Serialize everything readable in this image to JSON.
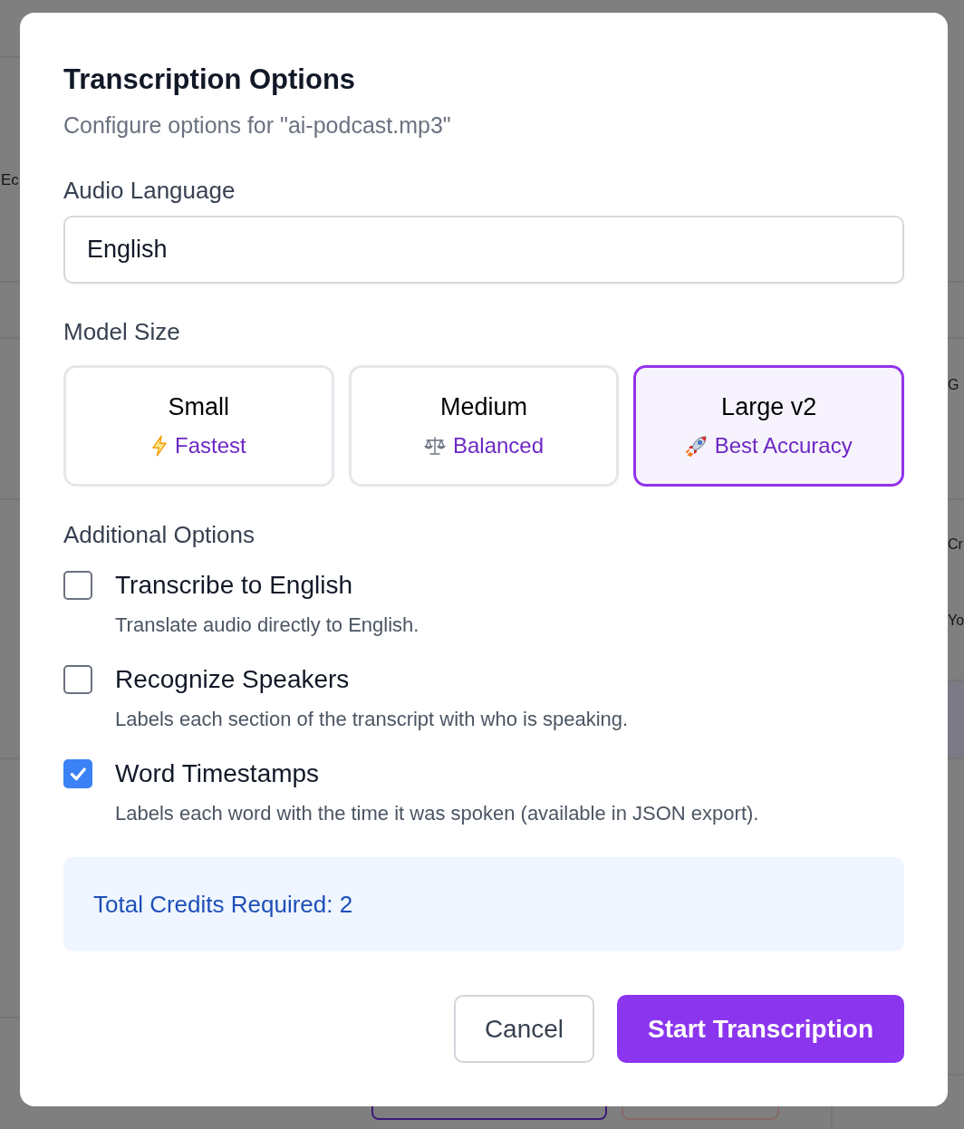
{
  "dialog": {
    "title": "Transcription Options",
    "subtitle": "Configure options for \"ai-podcast.mp3\""
  },
  "language": {
    "label": "Audio Language",
    "value": "English"
  },
  "model_size": {
    "label": "Model Size",
    "options": [
      {
        "name": "Small",
        "tagline": "Fastest",
        "selected": false
      },
      {
        "name": "Medium",
        "tagline": "Balanced",
        "selected": false
      },
      {
        "name": "Large v2",
        "tagline": "Best Accuracy",
        "selected": true
      }
    ]
  },
  "additional_options": {
    "label": "Additional Options",
    "options": [
      {
        "title": "Transcribe to English",
        "description": "Translate audio directly to English.",
        "checked": false
      },
      {
        "title": "Recognize Speakers",
        "description": "Labels each section of the transcript with who is speaking.",
        "checked": false
      },
      {
        "title": "Word Timestamps",
        "description": "Labels each word with the time it was spoken (available in JSON export).",
        "checked": true
      }
    ]
  },
  "credits": {
    "text": "Total Credits Required: 2"
  },
  "buttons": [
    {
      "label": "Cancel",
      "kind": "secondary"
    },
    {
      "label": "Start Transcription",
      "kind": "primary"
    }
  ],
  "background": {
    "left_fragments": [
      "Ec"
    ],
    "right_fragments": [
      "G",
      "Cr",
      "Yo"
    ]
  }
}
